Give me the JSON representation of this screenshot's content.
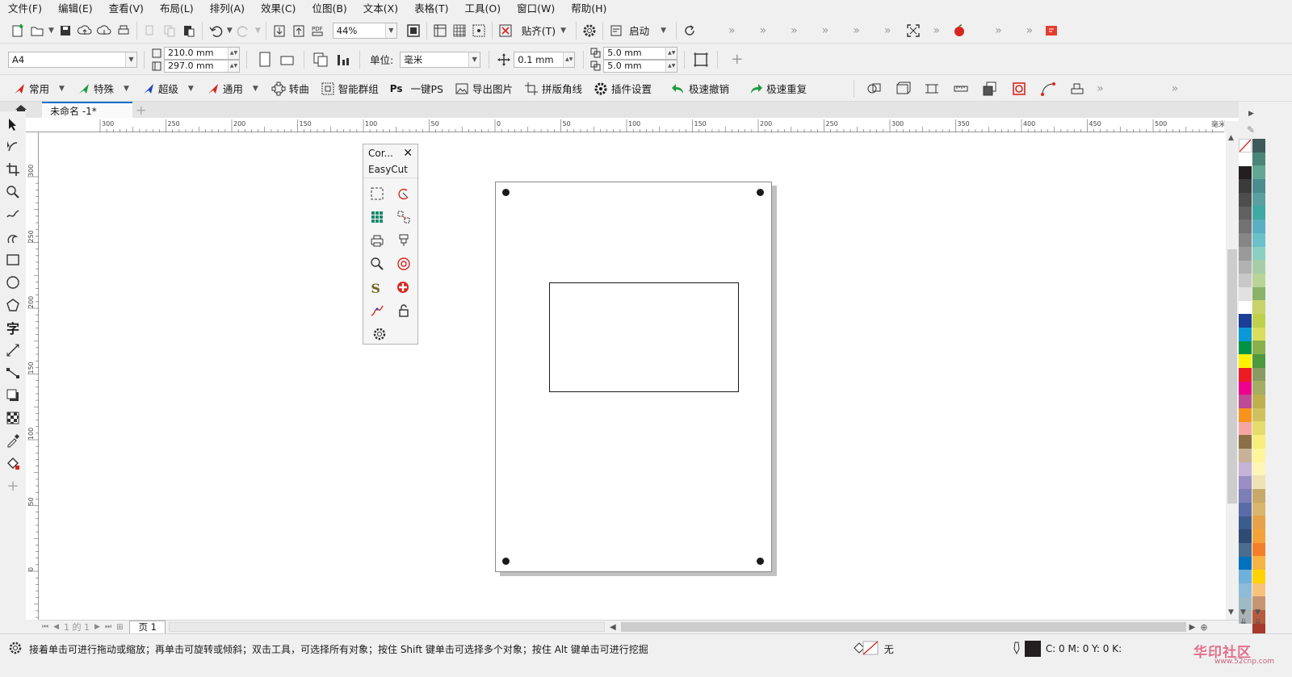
{
  "menu": [
    "文件(F)",
    "编辑(E)",
    "查看(V)",
    "布局(L)",
    "排列(A)",
    "效果(C)",
    "位图(B)",
    "文本(X)",
    "表格(T)",
    "工具(O)",
    "窗口(W)",
    "帮助(H)"
  ],
  "toolbar": {
    "zoom_value": "44%",
    "snap_label": "贴齐(T)",
    "launch_label": "启动"
  },
  "property_bar": {
    "page_size": "A4",
    "width": "210.0 mm",
    "height": "297.0 mm",
    "unit_label": "单位:",
    "unit_value": "毫米",
    "nudge": "0.1 mm",
    "dup_x": "5.0 mm",
    "dup_y": "5.0 mm"
  },
  "plugin_bar": {
    "items": [
      "常用",
      "特殊",
      "超级",
      "通用",
      "转曲",
      "智能群组",
      "一键PS",
      "导出图片",
      "拼版角线",
      "插件设置",
      "极速撤销",
      "极速重复"
    ],
    "ps_prefix": "Ps"
  },
  "document_tab": "未命名 -1*",
  "ruler_h_labels": [
    "300",
    "250",
    "200",
    "150",
    "100",
    "50",
    "0",
    "50",
    "100",
    "150",
    "200",
    "250",
    "300",
    "350",
    "400",
    "450",
    "500"
  ],
  "ruler_h_unit": "毫米",
  "ruler_v_labels": [
    "300",
    "250",
    "200",
    "150",
    "100",
    "50",
    "0"
  ],
  "docker": {
    "title": "Cor...",
    "name": "EasyCut"
  },
  "page_nav": {
    "counter": "1 的 1",
    "page_tab": "页 1"
  },
  "status": {
    "hint": "接着单击可进行拖动或缩放；再单击可旋转或倾斜；双击工具，可选择所有对象；按住 Shift 键单击可选择多个对象；按住 Alt 键单击可进行挖掘",
    "fill_label": "无",
    "cmyk": "C: 0 M: 0 Y: 0 K:"
  },
  "watermark": "华印社区",
  "watermark_url": "www.52cnp.com",
  "palette_colors_a": [
    "#ffffff",
    "#231f20",
    "#3b3b3b",
    "#4d4d4d",
    "#606060",
    "#727272",
    "#868686",
    "#9a9a9a",
    "#b1b1b1",
    "#c8c8c8",
    "#e1e1e1",
    "#ffffff",
    "#1b3e96",
    "#0b99d6",
    "#009245",
    "#fff200",
    "#ed1c24",
    "#ec008c",
    "#be4b96",
    "#f7941d",
    "#f6a6a1",
    "#8b6f47",
    "#c7b299",
    "#c6b3d8",
    "#9a8fc4",
    "#7c7fb6",
    "#5b6ba6",
    "#3c5c8c",
    "#2d4b73",
    "#4c6d8e",
    "#0071bc",
    "#6fb1d8",
    "#8fbbd9",
    "#9cbbc4",
    "#aab4b8"
  ],
  "palette_colors_b": [
    "#3d5a5a",
    "#4a8577",
    "#62a793",
    "#4b8c8e",
    "#5aa0a0",
    "#3fa9a3",
    "#5ab0c2",
    "#6cc0c9",
    "#8ccfc0",
    "#a5cda8",
    "#b8d497",
    "#8ab26b",
    "#c8d36c",
    "#bfd14b",
    "#d9de5b",
    "#8ab04c",
    "#4d9a3c",
    "#8a9a62",
    "#a4ad63",
    "#bfb04f",
    "#cfc25e",
    "#e3dd6c",
    "#f8ee7b",
    "#fff59a",
    "#fdf5b7",
    "#efe3b6",
    "#c9a96a",
    "#d9b56d",
    "#e6a24b",
    "#f2a33a",
    "#f47f2a",
    "#f5b343",
    "#ffd200",
    "#f9c27c",
    "#c59570",
    "#b65b3d",
    "#a53a2d"
  ]
}
